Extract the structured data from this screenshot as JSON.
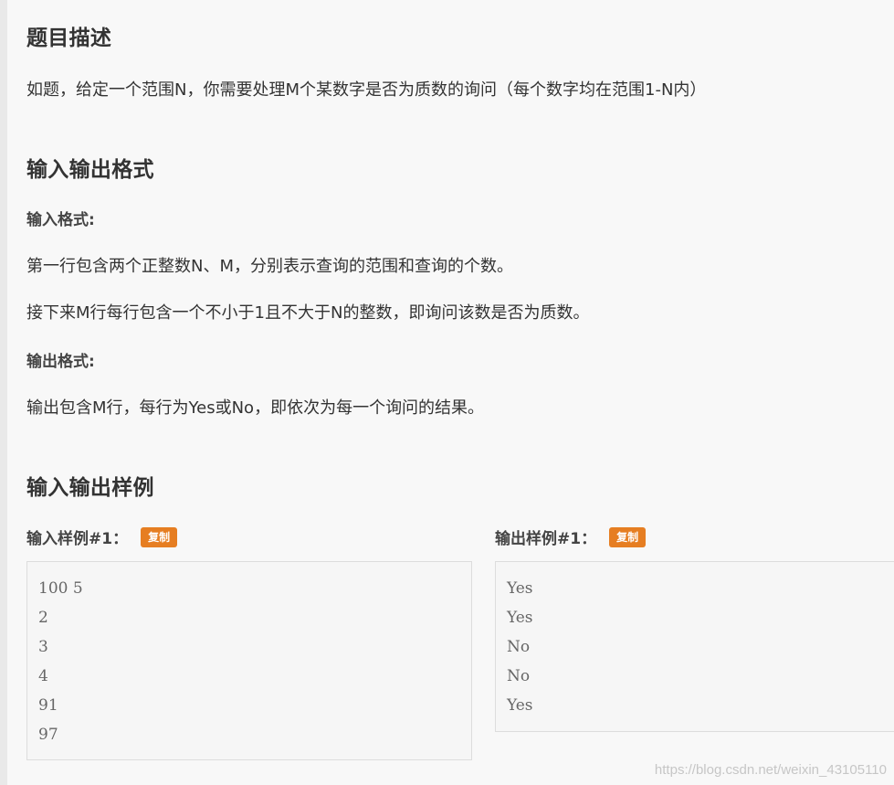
{
  "sections": {
    "description_title": "题目描述",
    "description_text": "如题，给定一个范围N，你需要处理M个某数字是否为质数的询问（每个数字均在范围1-N内）",
    "io_format_title": "输入输出格式",
    "input_format_label": "输入格式:",
    "input_line1": "第一行包含两个正整数N、M，分别表示查询的范围和查询的个数。",
    "input_line2": "接下来M行每行包含一个不小于1且不大于N的整数，即询问该数是否为质数。",
    "output_format_label": "输出格式:",
    "output_line1": "输出包含M行，每行为Yes或No，即依次为每一个询问的结果。",
    "samples_title": "输入输出样例"
  },
  "samples": {
    "input_label": "输入样例#1：",
    "output_label": "输出样例#1：",
    "copy_label": "复制",
    "input_lines": [
      "100 5",
      "2",
      "3",
      "4",
      "91",
      "97"
    ],
    "output_lines": [
      "Yes",
      "Yes",
      "No",
      "No",
      "Yes"
    ]
  },
  "watermark": "https://blog.csdn.net/weixin_43105110",
  "colors": {
    "accent": "#e67e22",
    "text": "#333333",
    "code_bg": "#f6f6f6"
  }
}
